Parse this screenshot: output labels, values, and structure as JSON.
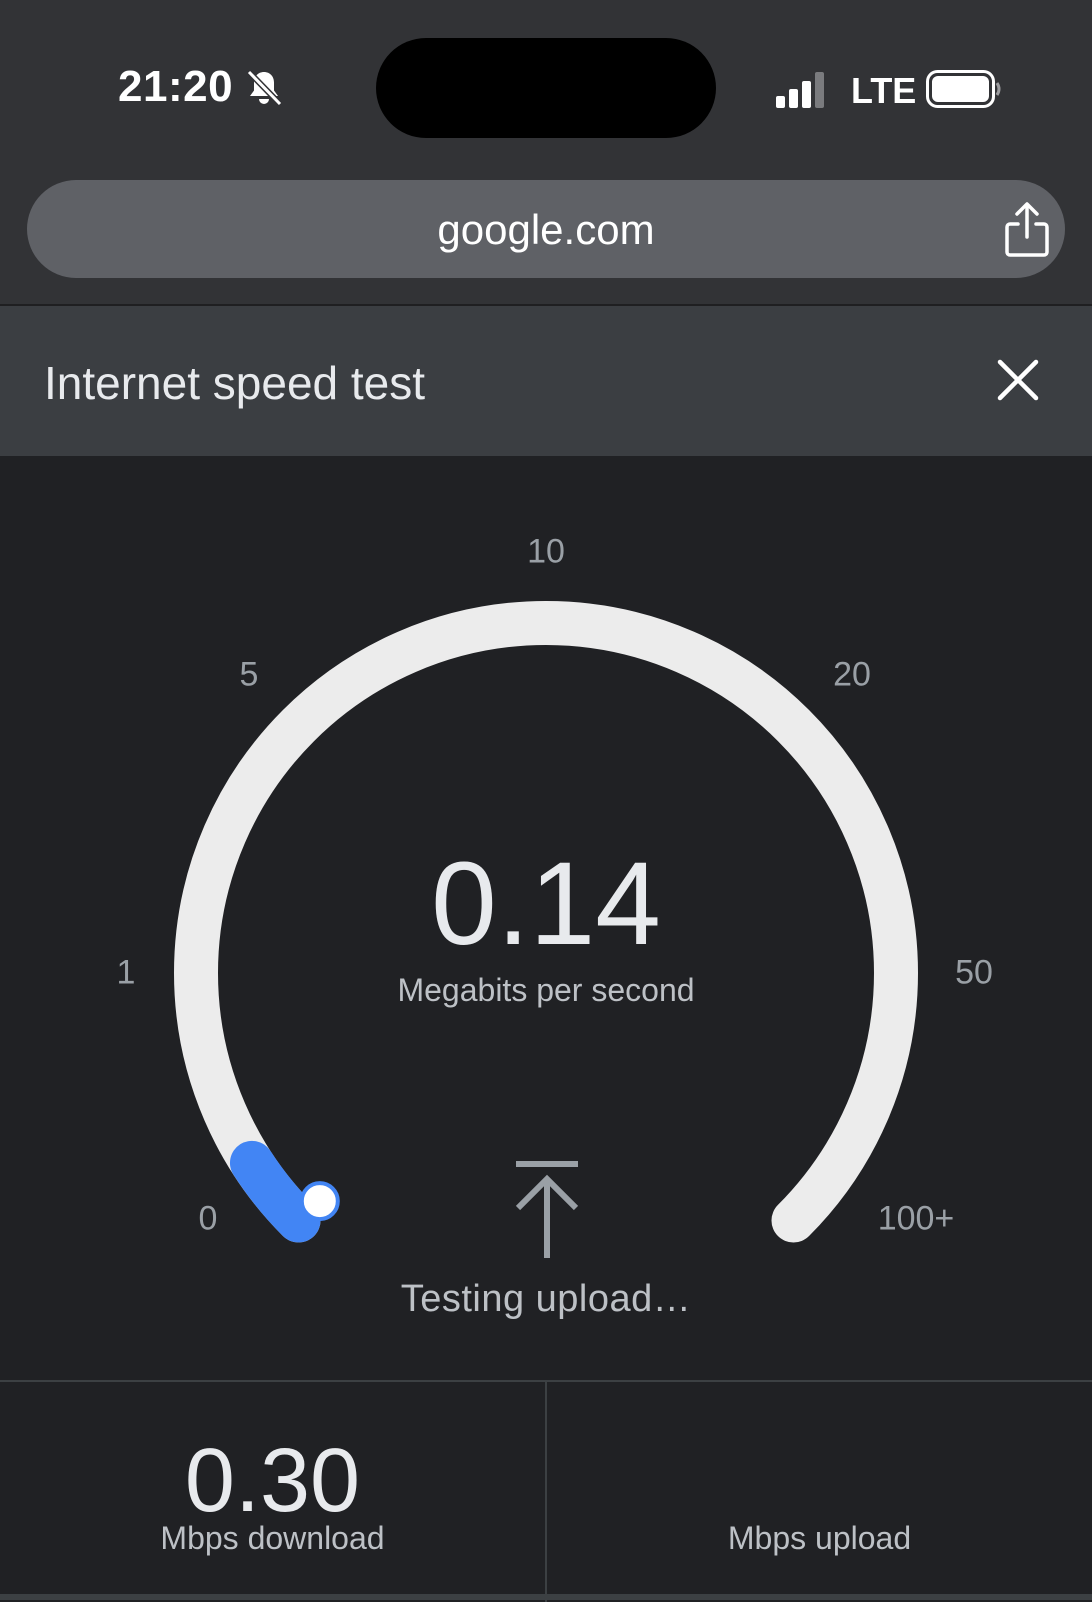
{
  "status_bar": {
    "time": "21:20",
    "network": "LTE",
    "icons": [
      "bell-slash-icon",
      "cellular-signal-icon",
      "battery-icon"
    ]
  },
  "browser": {
    "url": "google.com",
    "share_icon": "share-icon"
  },
  "card": {
    "title": "Internet speed test",
    "close_icon": "close-icon"
  },
  "gauge": {
    "ticks": [
      "0",
      "1",
      "5",
      "10",
      "20",
      "50",
      "100+"
    ],
    "current_value": "0.14",
    "unit": "Megabits per second",
    "status_icon": "upload-arrow-icon",
    "status": "Testing upload…",
    "needle_level": 0.02,
    "colors": {
      "track": "#ececec",
      "progress": "#4285f4",
      "background": "#202124"
    }
  },
  "results": {
    "download_value": "0.30",
    "download_label": "Mbps download",
    "upload_value": "",
    "upload_label": "Mbps upload"
  }
}
